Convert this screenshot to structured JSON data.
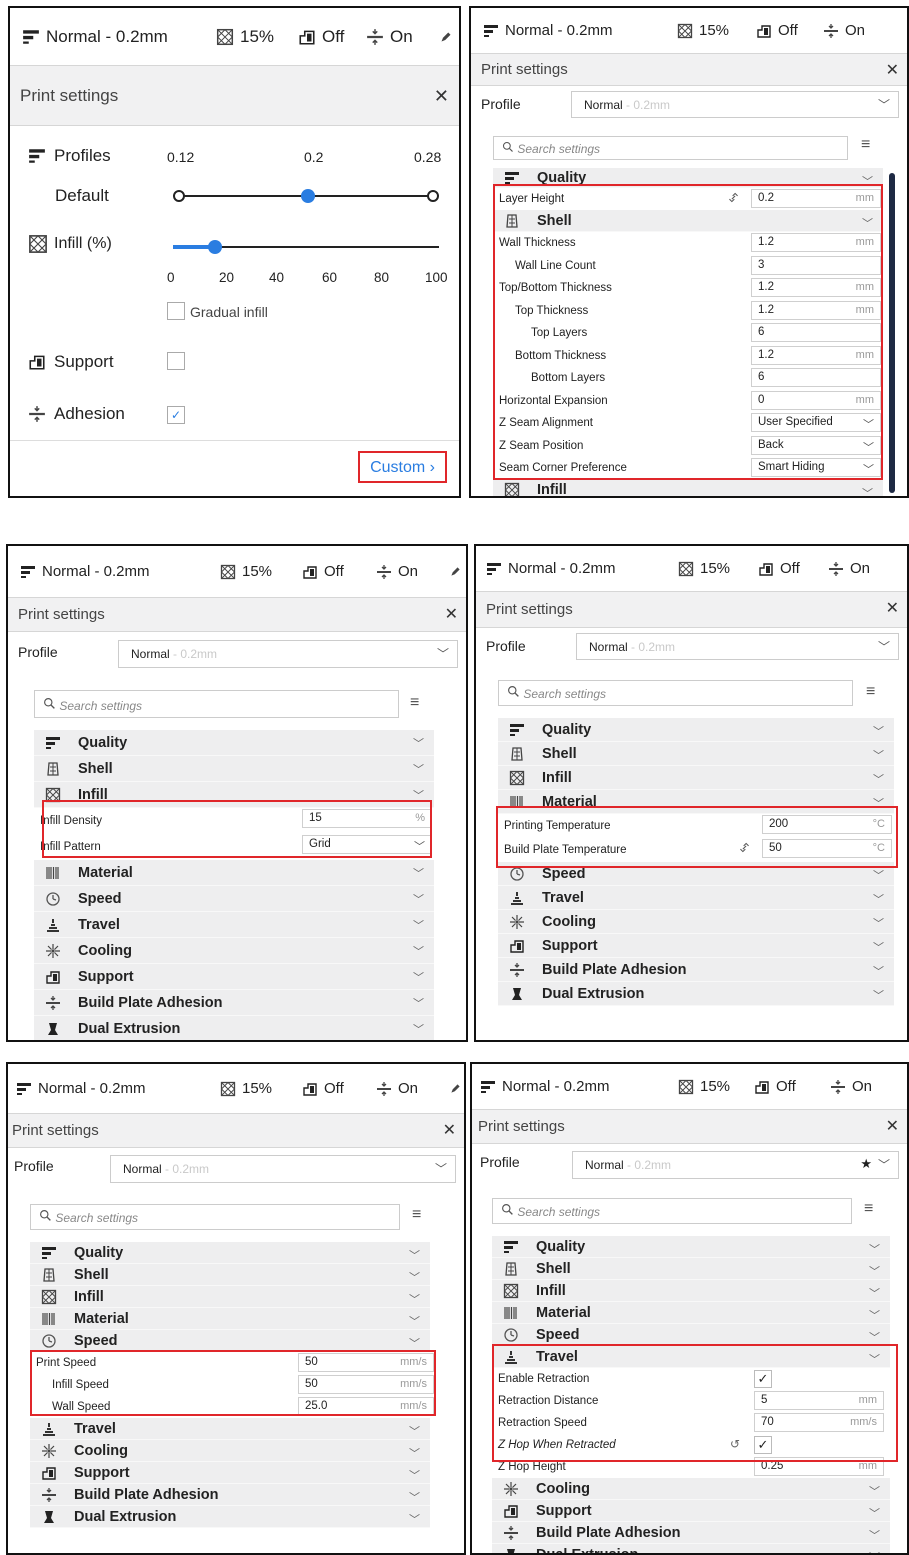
{
  "topbar": {
    "profile": "Normal - 0.2mm",
    "infill": "15%",
    "support": "Off",
    "adhesion": "On"
  },
  "print_settings_title": "Print settings",
  "recommended": {
    "profiles_label": "Profiles",
    "default_label": "Default",
    "profile_ticks": [
      "0.12",
      "0.2",
      "0.28"
    ],
    "layer_selected": 0.2,
    "infill_label": "Infill (%)",
    "infill_ticks": [
      "0",
      "20",
      "40",
      "60",
      "80",
      "100"
    ],
    "infill_value": 15,
    "gradual_infill_label": "Gradual infill",
    "gradual_infill_checked": false,
    "support_label": "Support",
    "support_checked": false,
    "adhesion_label": "Adhesion",
    "adhesion_checked": true,
    "custom_label": "Custom"
  },
  "custom": {
    "profile_label": "Profile",
    "profile_value_main": "Normal",
    "profile_value_dim": "- 0.2mm",
    "search_placeholder": "Search settings"
  },
  "categories": {
    "quality": "Quality",
    "shell": "Shell",
    "infill": "Infill",
    "material": "Material",
    "speed": "Speed",
    "travel": "Travel",
    "cooling": "Cooling",
    "support": "Support",
    "adhesion": "Build Plate Adhesion",
    "dual": "Dual Extrusion"
  },
  "quality_settings": [
    {
      "name": "Layer Height",
      "value": "0.2",
      "unit": "mm"
    }
  ],
  "shell_settings": [
    {
      "name": "Wall Thickness",
      "value": "1.2",
      "unit": "mm"
    },
    {
      "name": "Wall Line Count",
      "value": "3",
      "unit": ""
    },
    {
      "name": "Top/Bottom Thickness",
      "value": "1.2",
      "unit": "mm"
    },
    {
      "name": "Top Thickness",
      "value": "1.2",
      "unit": "mm"
    },
    {
      "name": "Top Layers",
      "value": "6",
      "unit": ""
    },
    {
      "name": "Bottom Thickness",
      "value": "1.2",
      "unit": "mm"
    },
    {
      "name": "Bottom Layers",
      "value": "6",
      "unit": ""
    },
    {
      "name": "Horizontal Expansion",
      "value": "0",
      "unit": "mm"
    },
    {
      "name": "Z Seam Alignment",
      "value": "User Specified",
      "unit": ""
    },
    {
      "name": "Z Seam Position",
      "value": "Back",
      "unit": ""
    },
    {
      "name": "Seam Corner Preference",
      "value": "Smart Hiding",
      "unit": ""
    }
  ],
  "infill_settings": [
    {
      "name": "Infill Density",
      "value": "15",
      "unit": "%"
    },
    {
      "name": "Infill Pattern",
      "value": "Grid",
      "unit": ""
    }
  ],
  "material_settings": [
    {
      "name": "Printing Temperature",
      "value": "200",
      "unit": "°C"
    },
    {
      "name": "Build Plate Temperature",
      "value": "50",
      "unit": "°C"
    }
  ],
  "speed_settings": [
    {
      "name": "Print Speed",
      "value": "50",
      "unit": "mm/s"
    },
    {
      "name": "Infill Speed",
      "value": "50",
      "unit": "mm/s"
    },
    {
      "name": "Wall Speed",
      "value": "25.0",
      "unit": "mm/s"
    }
  ],
  "travel_settings": [
    {
      "name": "Enable Retraction",
      "value": "✓",
      "unit": ""
    },
    {
      "name": "Retraction Distance",
      "value": "5",
      "unit": "mm"
    },
    {
      "name": "Retraction Speed",
      "value": "70",
      "unit": "mm/s"
    },
    {
      "name": "Z Hop When Retracted",
      "value": "✓",
      "unit": ""
    },
    {
      "name": "Z Hop Height",
      "value": "0.25",
      "unit": "mm"
    }
  ]
}
